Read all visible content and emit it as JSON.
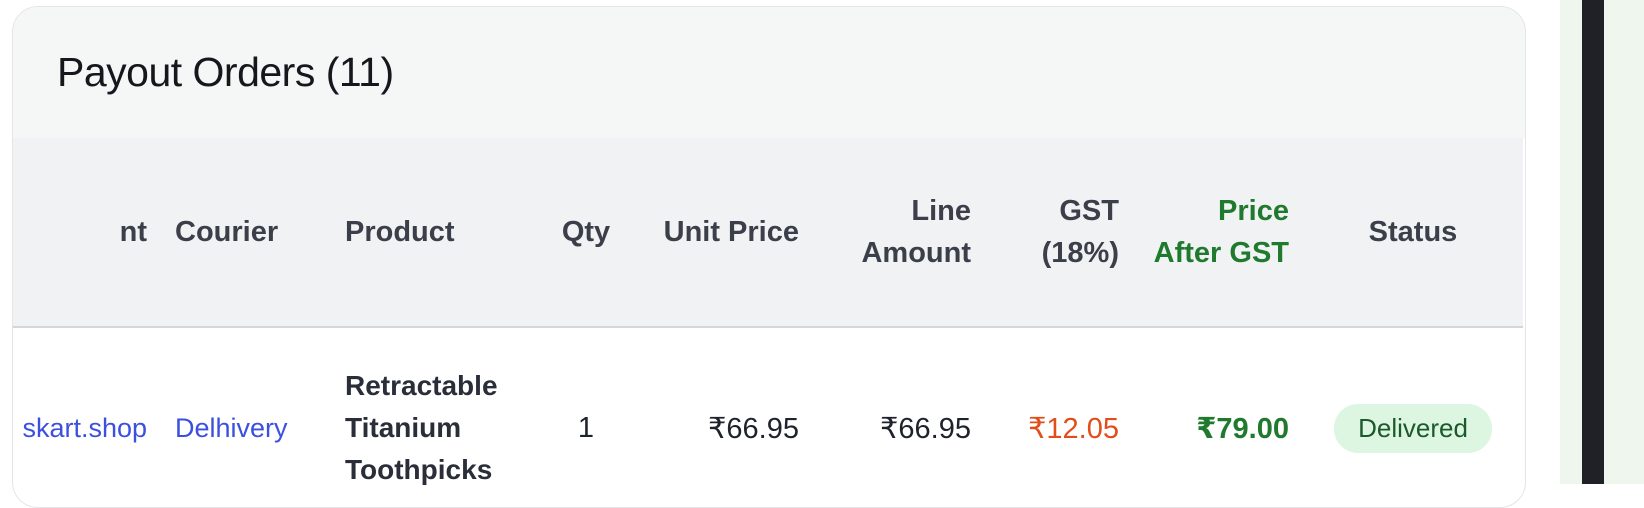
{
  "card": {
    "title": "Payout Orders (11)"
  },
  "table": {
    "headers": {
      "merchant": "nt",
      "courier": "Courier",
      "product": "Product",
      "qty": "Qty",
      "unit_price": "Unit Price",
      "line_amount": "Line Amount",
      "gst": "GST (18%)",
      "price_after_gst": "Price After GST",
      "status": "Status"
    },
    "rows": [
      {
        "merchant": "skart.shop",
        "courier": "Delhivery",
        "product": "Retractable Titanium Toothpicks",
        "qty": "1",
        "unit_price": "₹66.95",
        "line_amount": "₹66.95",
        "gst": "₹12.05",
        "price_after_gst": "₹79.00",
        "status": "Delivered"
      }
    ]
  },
  "colors": {
    "link": "#3b4fe0",
    "gst_value": "#e34d1a",
    "price_after_gst": "#1f7a2e",
    "status_badge_bg": "#dcf6e2"
  }
}
